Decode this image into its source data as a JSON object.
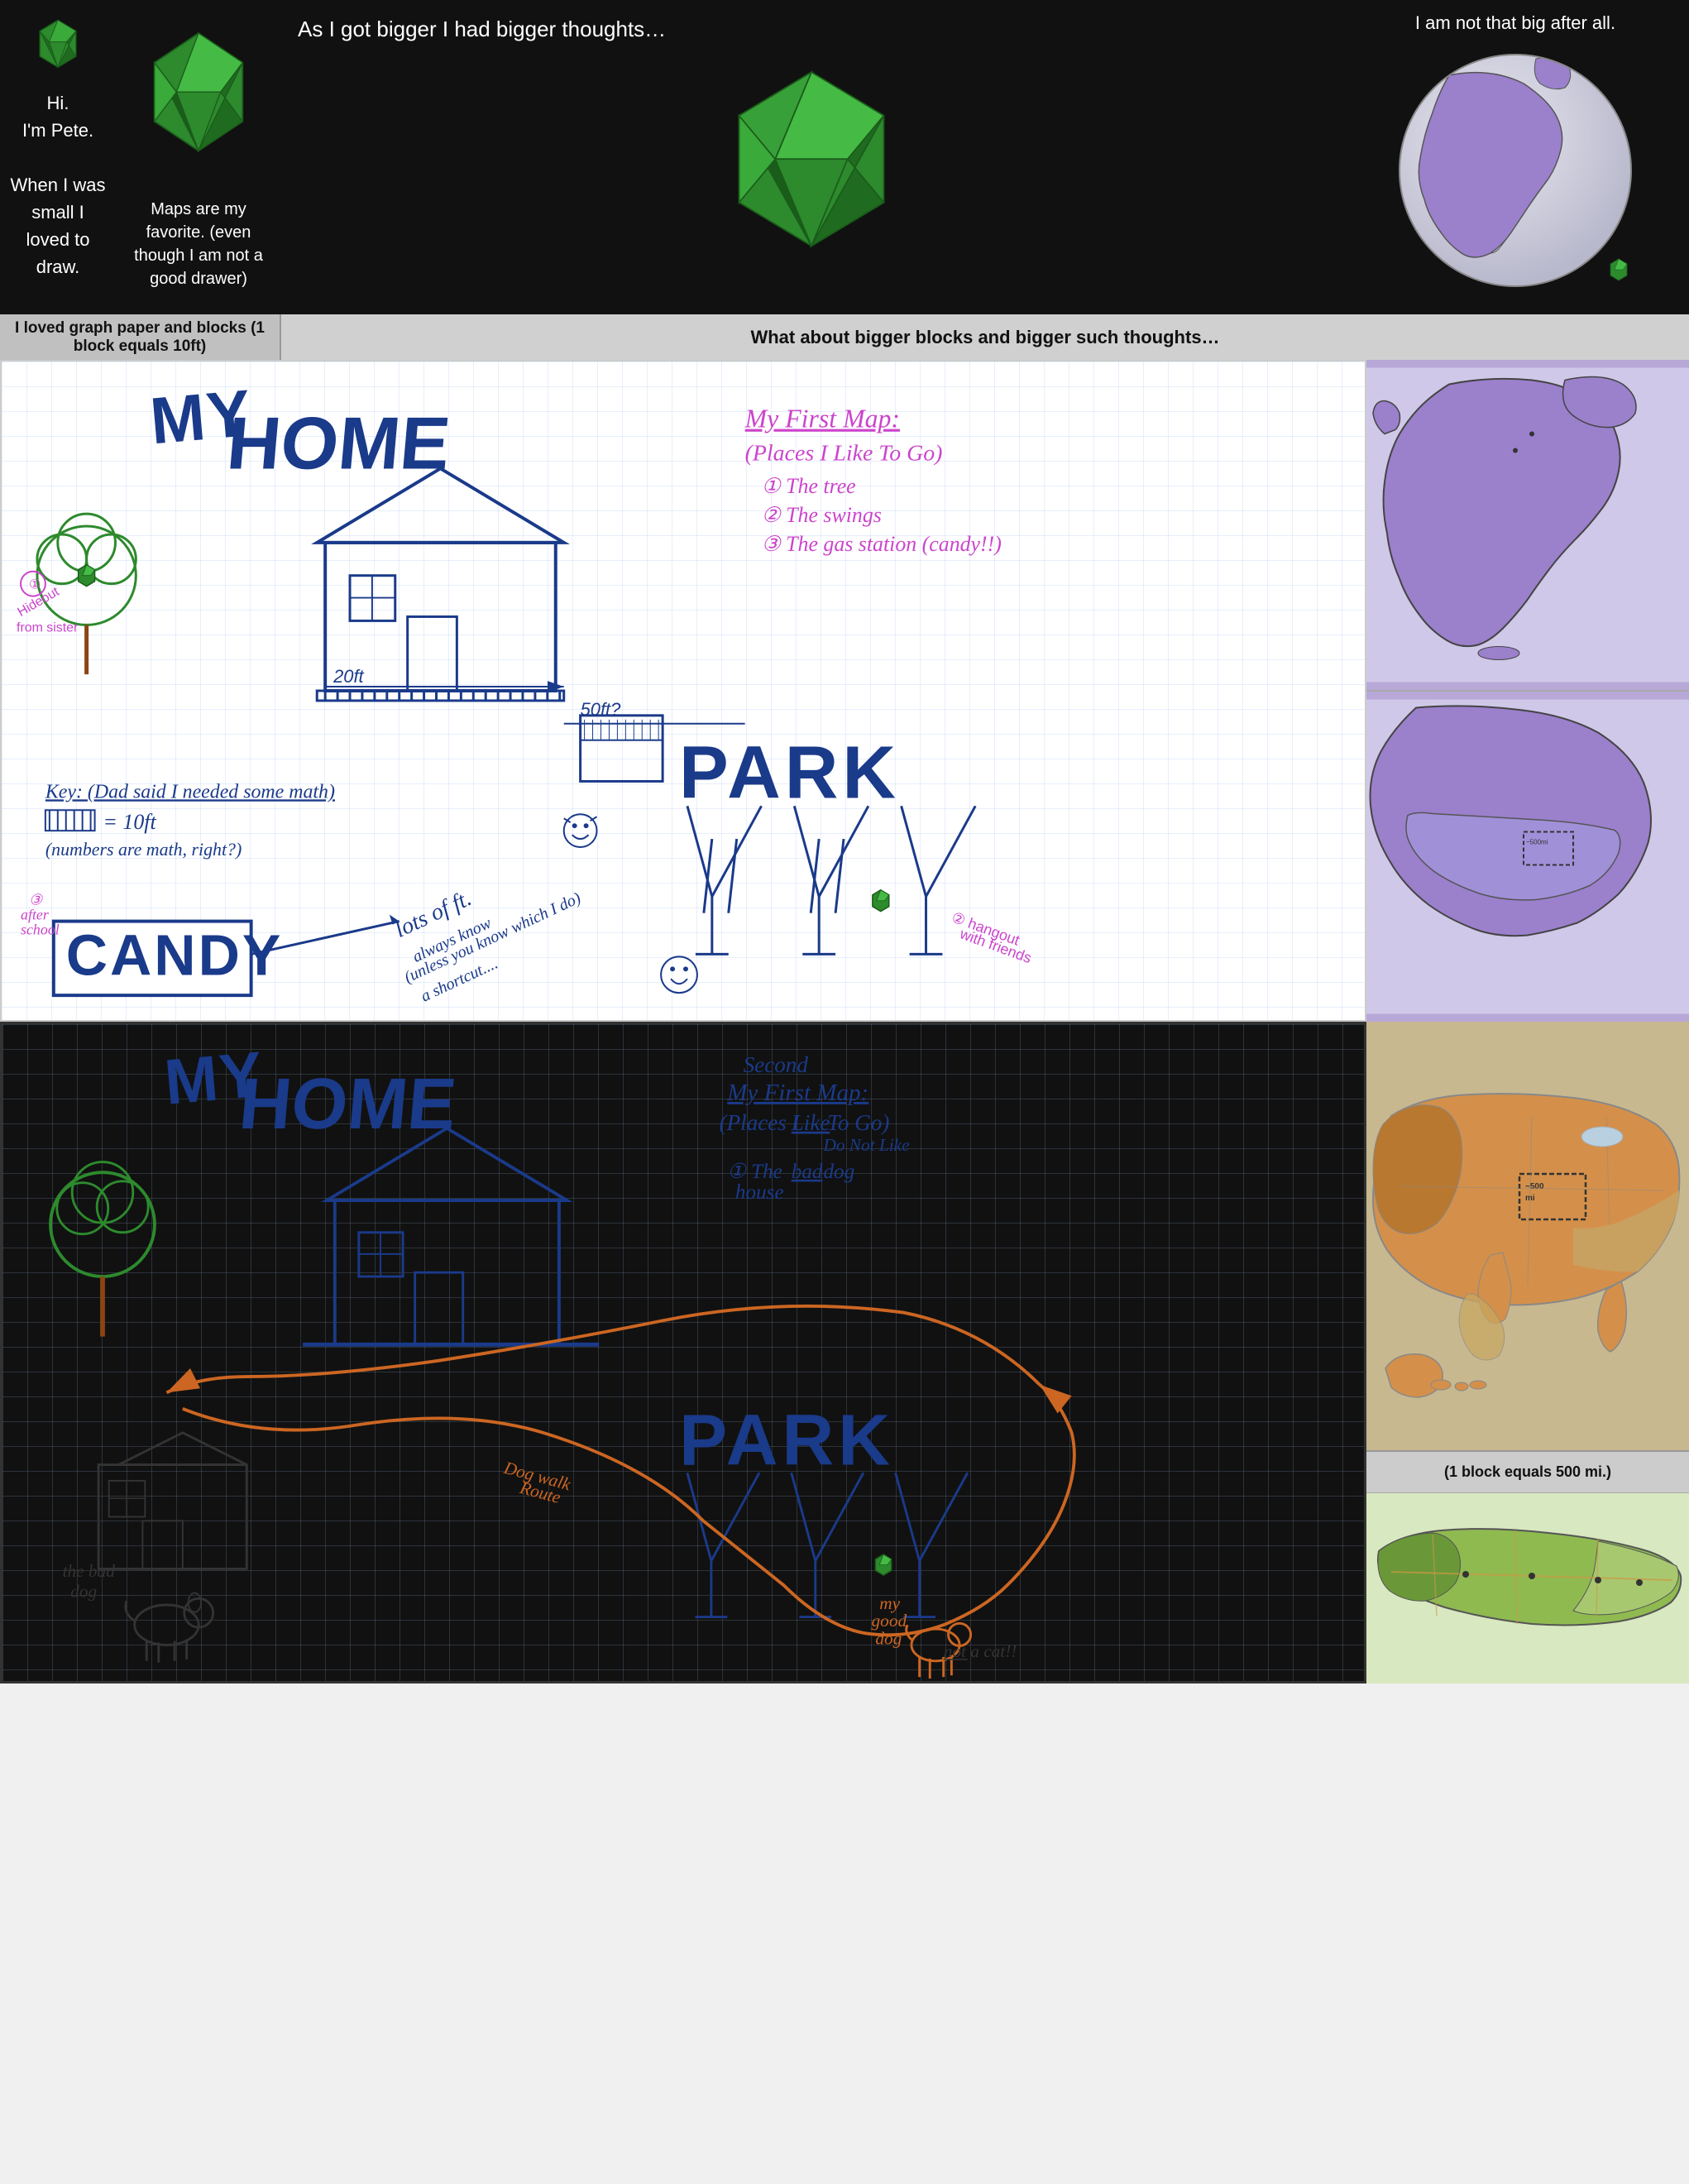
{
  "top": {
    "panel_pete": {
      "text1": "Hi.",
      "text2": "I'm Pete.",
      "text3": "When I was small I loved to draw."
    },
    "panel_maps": {
      "text": "Maps are my favorite. (even though I am not a good drawer)"
    },
    "panel_bigger": {
      "title": "As I got bigger I had bigger thoughts…"
    },
    "panel_globe": {
      "title": "I am not that big after all."
    }
  },
  "captions": {
    "left": "I loved graph paper and blocks (1 block equals 10ft)",
    "right": "What about bigger blocks and bigger such thoughts…"
  },
  "map1": {
    "title": "My First Map:",
    "subtitle": "(Places I Like To Go)",
    "items": [
      "① The tree",
      "② The swings",
      "③ The gas station (candy!!)"
    ],
    "home_label": "MY HOME",
    "park_label": "PARK",
    "candy_label": "CANDY",
    "annotation1": "Hideout from sister",
    "annotation2": "20ft",
    "annotation3": "50ft?",
    "key_text": "Key: (Dad said I needed some math)",
    "key_value": "= 10ft",
    "key_note": "(numbers are math, right?)",
    "distance_text": "lots of ft.",
    "distance_note": "always know\n(unless you which I do)\na shortcut....",
    "hangout_text": "② hangout with friends",
    "afterschool": "③ after school"
  },
  "map2": {
    "title": "Second My First Map:",
    "subtitle": "(Places I Like To Go)",
    "do_not_like": "Do Not Like",
    "items": [
      "① The bad dog house"
    ],
    "park_label": "PARK",
    "dog_walk": "Dog walk Route",
    "my_good_dog": "my good dog",
    "not_a_cat": "not a cat!!",
    "the_bad_dog": "the bad dog"
  },
  "right_panels": {
    "block_caption": "(1 block equals 500 mi.)"
  }
}
